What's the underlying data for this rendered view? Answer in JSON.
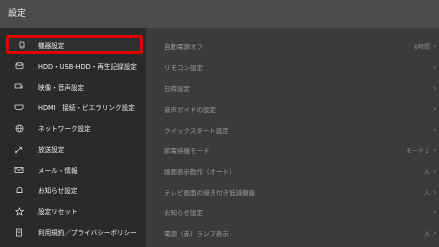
{
  "header": {
    "title": "設定"
  },
  "menu": [
    {
      "label": "機器設定",
      "icon": "device-icon",
      "selected": true
    },
    {
      "label": "HDD・USB-HDD・再生記録設定",
      "icon": "hdd-icon"
    },
    {
      "label": "映像・音声設定",
      "icon": "av-icon"
    },
    {
      "label": "HDMI　接続・ビエラリンク設定",
      "icon": "hdmi-icon"
    },
    {
      "label": "ネットワーク設定",
      "icon": "network-icon"
    },
    {
      "label": "放送設定",
      "icon": "broadcast-icon"
    },
    {
      "label": "メール・情報",
      "icon": "mail-icon"
    },
    {
      "label": "お知らせ設定",
      "icon": "bell-icon"
    },
    {
      "label": "設定リセット",
      "icon": "star-icon"
    },
    {
      "label": "利用規約／プライバシーポリシー",
      "icon": "document-icon"
    }
  ],
  "settings": [
    {
      "label": "自動電源オフ",
      "value": "6時間"
    },
    {
      "label": "リモコン設定",
      "value": ""
    },
    {
      "label": "日時設定",
      "value": ""
    },
    {
      "label": "音声ガイドの設定",
      "value": ""
    },
    {
      "label": "クイックスタート設定",
      "value": ""
    },
    {
      "label": "節電待機モード",
      "value": "モード１"
    },
    {
      "label": "画面表示動作（オート）",
      "value": "入"
    },
    {
      "label": "テレビ画面の焼き付き低減機能",
      "value": "入"
    },
    {
      "label": "お知らせ設定",
      "value": ""
    },
    {
      "label": "電源（赤）ランプ表示",
      "value": "入"
    }
  ],
  "colors": {
    "selection_border": "#e00000",
    "header_bg": "#4b4b4b",
    "left_bg": "#2a2a2a",
    "right_bg": "#3b3b3b"
  }
}
